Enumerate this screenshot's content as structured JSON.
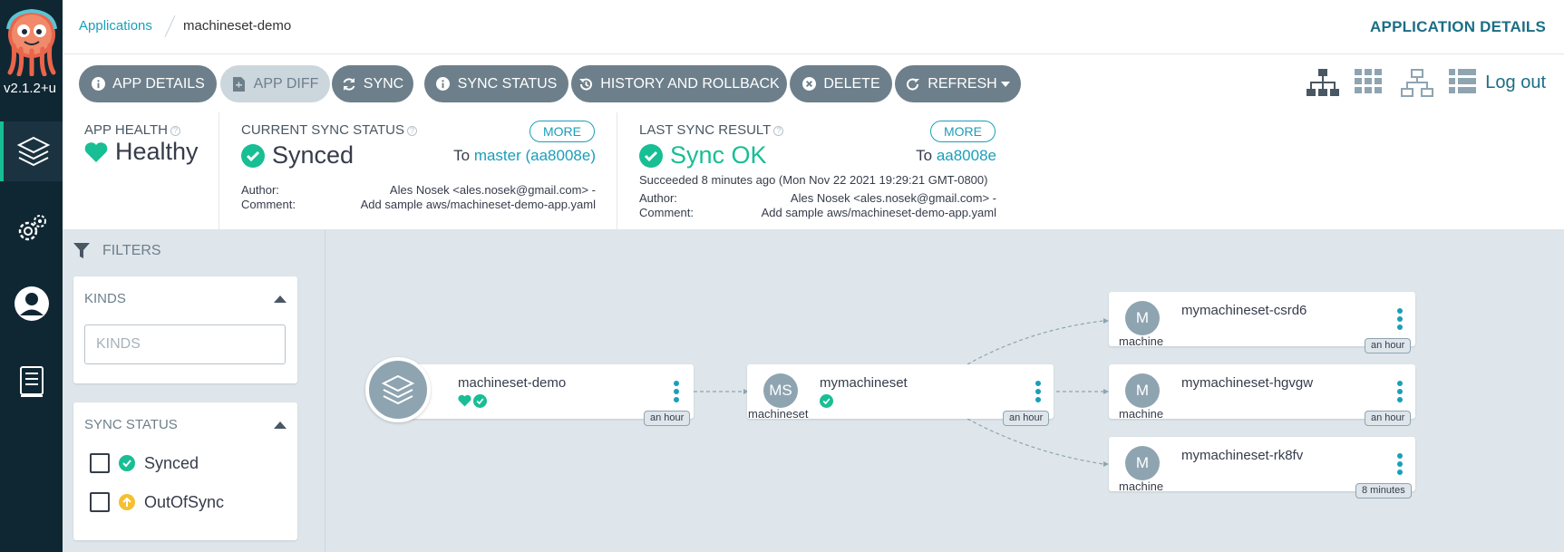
{
  "app": {
    "version": "v2.1.2+u"
  },
  "header": {
    "breadcrumb_link": "Applications",
    "breadcrumb_current": "machineset-demo",
    "page_title": "APPLICATION DETAILS",
    "logout": "Log out"
  },
  "toolbar": {
    "buttons": [
      {
        "label": "APP DETAILS",
        "icon": "info-icon",
        "enabled": true
      },
      {
        "label": "APP DIFF",
        "icon": "file-diff-icon",
        "enabled": false
      },
      {
        "label": "SYNC",
        "icon": "sync-icon",
        "enabled": true
      },
      {
        "label": "SYNC STATUS",
        "icon": "info-icon",
        "enabled": true
      },
      {
        "label": "HISTORY AND ROLLBACK",
        "icon": "history-icon",
        "enabled": true
      },
      {
        "label": "DELETE",
        "icon": "times-circle-icon",
        "enabled": true
      },
      {
        "label": "REFRESH",
        "icon": "redo-icon",
        "enabled": true,
        "dropdown": true
      }
    ],
    "view_icons": [
      "tree-view-icon",
      "pods-view-icon",
      "network-view-icon",
      "list-view-icon"
    ]
  },
  "status": {
    "health": {
      "label": "APP HEALTH",
      "value": "Healthy",
      "color": "#18be94"
    },
    "sync": {
      "label": "CURRENT SYNC STATUS",
      "more": "MORE",
      "value": "Synced",
      "to_prefix": "To",
      "to_revision": "master (aa8008e)",
      "author_label": "Author:",
      "author": "Ales Nosek <ales.nosek@gmail.com> -",
      "comment_label": "Comment:",
      "comment": "Add sample aws/machineset-demo-app.yaml"
    },
    "last_sync": {
      "label": "LAST SYNC RESULT",
      "more": "MORE",
      "value": "Sync OK",
      "to_prefix": "To",
      "to_revision": "aa8008e",
      "succeeded": "Succeeded 8 minutes ago (Mon Nov 22 2021 19:29:21 GMT-0800)",
      "author_label": "Author:",
      "author": "Ales Nosek <ales.nosek@gmail.com> -",
      "comment_label": "Comment:",
      "comment": "Add sample aws/machineset-demo-app.yaml"
    }
  },
  "filters": {
    "title": "FILTERS",
    "kinds": {
      "title": "KINDS",
      "placeholder": "KINDS"
    },
    "sync_status": {
      "title": "SYNC STATUS",
      "options": [
        {
          "label": "Synced",
          "icon": "check-circle-icon",
          "color": "#18be94"
        },
        {
          "label": "OutOfSync",
          "icon": "arrow-circle-up-icon",
          "color": "#f4c030"
        }
      ]
    }
  },
  "graph": {
    "app_node": {
      "name": "machineset-demo",
      "age": "an hour"
    },
    "machineset_node": {
      "avatar": "MS",
      "name": "mymachineset",
      "kind": "machineset",
      "age": "an hour"
    },
    "machine_nodes": [
      {
        "avatar": "M",
        "name": "mymachineset-csrd6",
        "kind": "machine",
        "age": "an hour"
      },
      {
        "avatar": "M",
        "name": "mymachineset-hgvgw",
        "kind": "machine",
        "age": "an hour"
      },
      {
        "avatar": "M",
        "name": "mymachineset-rk8fv",
        "kind": "machine",
        "age": "8 minutes"
      }
    ]
  }
}
